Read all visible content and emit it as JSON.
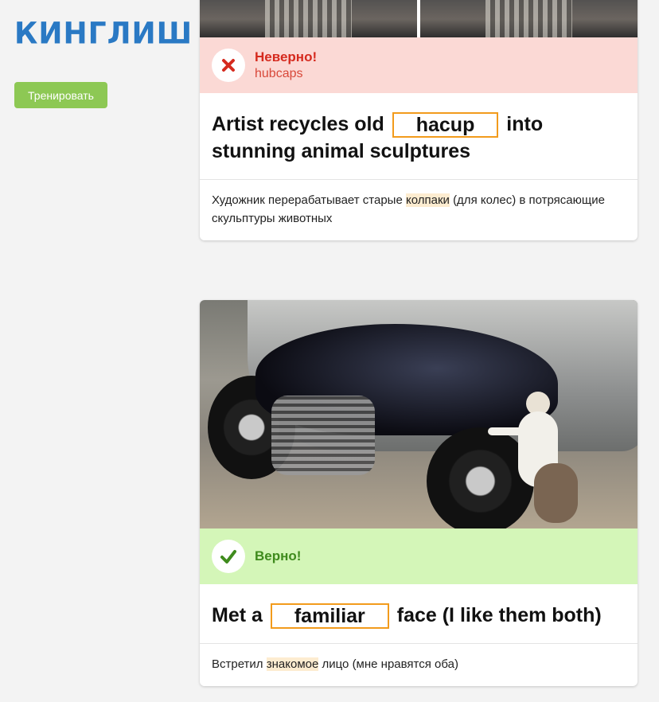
{
  "app": {
    "logo": "КИНГЛИШ"
  },
  "sidebar": {
    "train_button": "Тренировать"
  },
  "cards": [
    {
      "result_title": "Неверно!",
      "result_answer": "hubcaps",
      "sentence_before": "Artist recycles old",
      "blank_value": "hacup",
      "sentence_after_1": "into",
      "sentence_after_2": "stunning animal sculptures",
      "translation_before": "Художник перерабатывает старые",
      "translation_highlight": "колпаки",
      "translation_after": "(для колес) в потрясающие скульптуры животных"
    },
    {
      "result_title": "Верно!",
      "sentence_before": "Met a",
      "blank_value": "familiar",
      "sentence_after_1": "face (I like them both)",
      "translation_before": "Встретил",
      "translation_highlight": "знакомое",
      "translation_after": "лицо (мне нравятся оба)"
    }
  ],
  "colors": {
    "wrong_bg": "#fbd9d5",
    "right_bg": "#d4f6b8",
    "accent": "#f29b1c",
    "button": "#8dc854"
  },
  "icons": [
    "cross-icon",
    "check-icon"
  ]
}
